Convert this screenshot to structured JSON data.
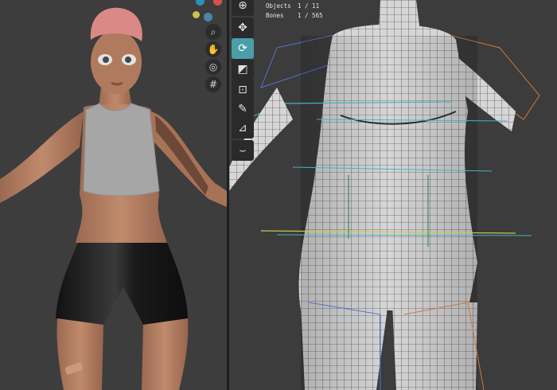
{
  "stats": {
    "objects_label": "Objects",
    "objects_value": "1 / 11",
    "bones_label": "Bones",
    "bones_value": "1 / 565"
  },
  "colors": {
    "viewport_bg": "#3d3d3d",
    "active_tool": "#4a9ea8",
    "skin": "#b07a5e",
    "hair": "#d98a86",
    "shorts": "#1b1b1b",
    "tank_top": "#a8a8a8",
    "wire": "#1e1e1e",
    "rig_cyan": "#3fb6c0",
    "rig_orange": "#d0773a",
    "rig_blue": "#5a6fd0"
  },
  "icons": {
    "nav": [
      "zoom-icon",
      "hand-pan-icon",
      "camera-icon",
      "grid-icon"
    ],
    "tools": [
      "cursor-icon",
      "move-icon",
      "rotate-icon",
      "scale-icon",
      "transform-icon",
      "annotate-icon",
      "measure-icon",
      "bone-envelope-icon"
    ]
  }
}
